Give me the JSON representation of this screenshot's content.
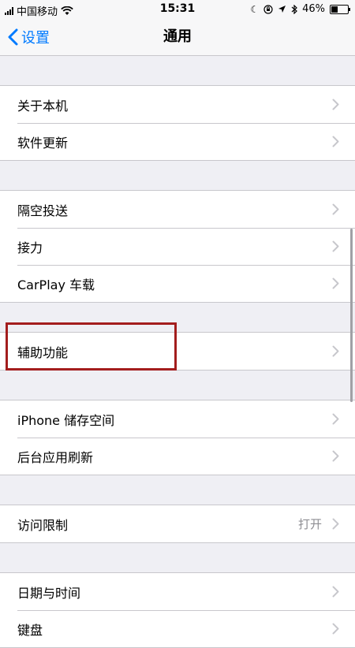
{
  "status_bar": {
    "carrier": "中国移动",
    "time": "15:31",
    "battery_percent": "46%",
    "battery_level": 0.46,
    "icons": [
      "signal-icon",
      "wifi-icon",
      "moon-icon",
      "lock-rotation-icon",
      "location-icon",
      "bluetooth-icon",
      "battery-icon"
    ]
  },
  "nav": {
    "back_label": "设置",
    "title": "通用"
  },
  "groups": [
    {
      "rows": [
        {
          "label": "关于本机"
        },
        {
          "label": "软件更新"
        }
      ]
    },
    {
      "rows": [
        {
          "label": "隔空投送"
        },
        {
          "label": "接力"
        },
        {
          "label": "CarPlay 车载"
        }
      ]
    },
    {
      "rows": [
        {
          "label": "辅助功能"
        }
      ]
    },
    {
      "rows": [
        {
          "label": "iPhone 储存空间"
        },
        {
          "label": "后台应用刷新"
        }
      ]
    },
    {
      "rows": [
        {
          "label": "访问限制",
          "value": "打开"
        }
      ]
    },
    {
      "rows": [
        {
          "label": "日期与时间"
        },
        {
          "label": "键盘"
        }
      ]
    }
  ],
  "colors": {
    "accent": "#007aff",
    "highlight_box": "#a31d1d",
    "background": "#efeff4"
  }
}
